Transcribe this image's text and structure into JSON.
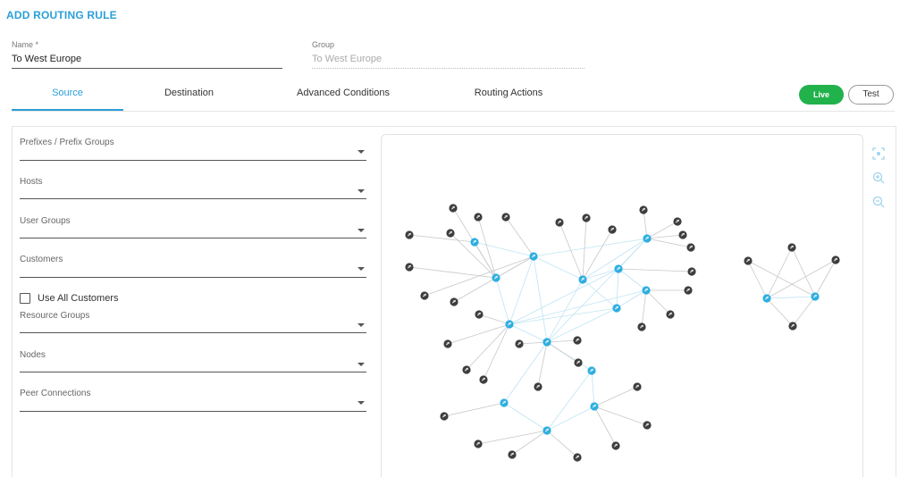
{
  "page": {
    "title": "ADD ROUTING RULE"
  },
  "form": {
    "name_label": "Name *",
    "name_value": "To West Europe",
    "group_label": "Group",
    "group_value": "To West Europe"
  },
  "tabs": [
    {
      "label": "Source",
      "active": true
    },
    {
      "label": "Destination",
      "active": false
    },
    {
      "label": "Advanced Conditions",
      "active": false
    },
    {
      "label": "Routing Actions",
      "active": false
    }
  ],
  "mode_buttons": {
    "live": "Live",
    "test": "Test"
  },
  "source_fields": {
    "prefixes": "Prefixes / Prefix Groups",
    "hosts": "Hosts",
    "user_groups": "User Groups",
    "customers": "Customers",
    "use_all_customers": "Use All Customers",
    "resource_groups": "Resource Groups",
    "nodes": "Nodes",
    "peer_connections": "Peer Connections"
  },
  "graph_toolbar": {
    "icons": [
      "focus-icon",
      "zoom-in-icon",
      "zoom-out-icon"
    ]
  },
  "colors": {
    "accent": "#2a9fd8",
    "live_green": "#22b24c",
    "hub_blue": "#2eaee0",
    "peer_dark": "#3d3d3d"
  }
}
